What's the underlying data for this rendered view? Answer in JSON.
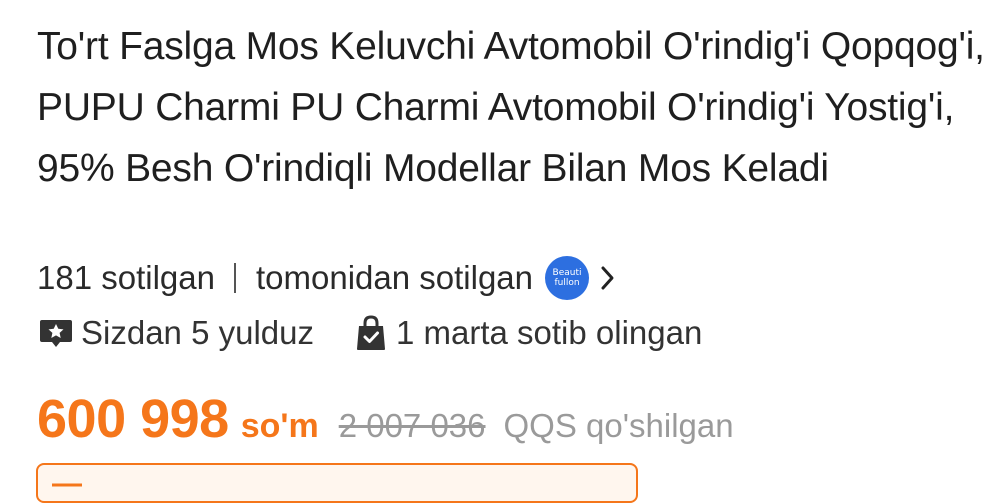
{
  "product": {
    "title": "To'rt Faslga Mos Keluvchi Avtomobil O'rindig'i Qopqog'i, PUPU Charmi PU Charmi Avtomobil O'rindig'i Yostig'i, 95% Besh O'rindiqli Modellar Bilan Mos Keladi"
  },
  "meta": {
    "sold_count": "181 sotilgan",
    "sold_by": "tomonidan sotilgan",
    "seller_badge_line1": "Beauti",
    "seller_badge_line2": "fullon",
    "seller_chevron_icon": "chevron-right-icon"
  },
  "stats": {
    "rating_icon": "star-message-icon",
    "rating_text": "Sizdan 5 yulduz",
    "purchase_icon": "shopping-bag-check-icon",
    "purchase_text": "1 marta sotib olingan"
  },
  "pricing": {
    "price": "600 998",
    "currency": "so'm",
    "old_price": "2 007 036",
    "vat_note": "QQS qo'shilgan",
    "accent_color": "#f5761a"
  },
  "promo": {
    "text": "—"
  }
}
